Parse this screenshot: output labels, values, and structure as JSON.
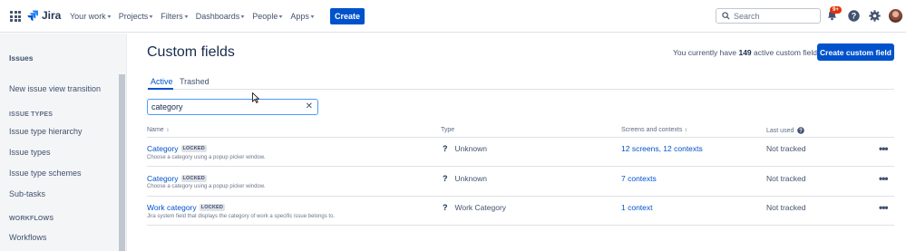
{
  "nav": {
    "product": "Jira",
    "menus": [
      "Your work",
      "Projects",
      "Filters",
      "Dashboards",
      "People",
      "Apps"
    ],
    "create_label": "Create",
    "search_placeholder": "Search",
    "notifications_badge": "9+"
  },
  "sidebar": {
    "title": "Issues",
    "item_transition": "New issue view transition",
    "section_issue_types": "ISSUE TYPES",
    "issue_types_items": [
      "Issue type hierarchy",
      "Issue types",
      "Issue type schemes",
      "Sub-tasks"
    ],
    "section_workflows": "WORKFLOWS",
    "workflows_items": [
      "Workflows"
    ]
  },
  "main": {
    "title": "Custom fields",
    "count_prefix": "You currently have ",
    "count_value": "149",
    "count_suffix": " active custom fields",
    "create_button": "Create custom field",
    "tabs": [
      "Active",
      "Trashed"
    ],
    "filter_value": "category",
    "columns": [
      "Name",
      "Type",
      "Screens and contexts",
      "Last used"
    ],
    "locked_label": "LOCKED",
    "rows": [
      {
        "name": "Category",
        "desc": "Choose a category using a popup picker window.",
        "type": "Unknown",
        "screens": "12 screens, 12 contexts",
        "last_used": "Not tracked"
      },
      {
        "name": "Category",
        "desc": "Choose a category using a popup picker window.",
        "type": "Unknown",
        "screens": "7 contexts",
        "last_used": "Not tracked"
      },
      {
        "name": "Work category",
        "desc": "Jira system field that displays the category of work a specific issue belongs to.",
        "type": "Work Category",
        "screens": "1 context",
        "last_used": "Not tracked"
      }
    ]
  },
  "colors": {
    "brand": "#0052cc",
    "badge": "#de350b",
    "focus": "#4c9aff"
  }
}
